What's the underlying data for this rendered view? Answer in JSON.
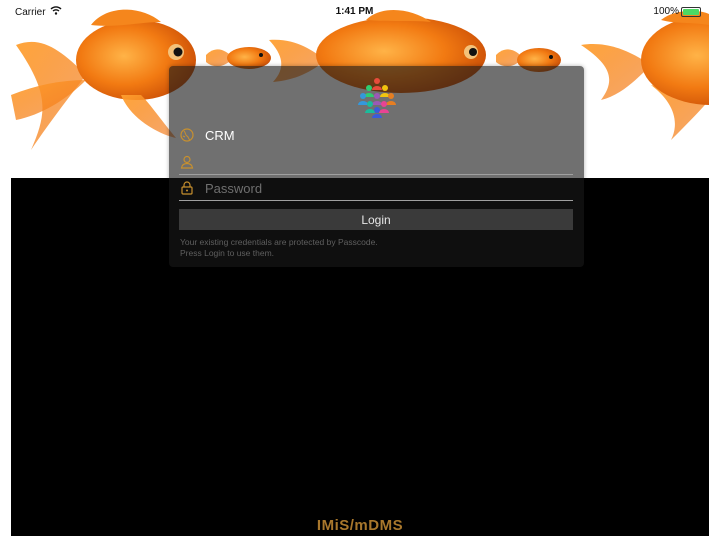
{
  "status_bar": {
    "carrier": "Carrier",
    "time": "1:41 PM",
    "battery": "100%",
    "wifi_icon": "wifi-icon",
    "battery_icon": "battery-icon",
    "battery_color": "#4cd964"
  },
  "login": {
    "server_icon": "globe-icon",
    "server_name": "CRM",
    "username_icon": "user-icon",
    "username_value": "",
    "username_placeholder": "",
    "password_icon": "lock-icon",
    "password_placeholder": "Password",
    "login_button": "Login",
    "note_line1": "Your existing credentials are protected by Passcode.",
    "note_line2": "Press Login to use them.",
    "accent_color": "#c8902e"
  },
  "footer": {
    "brand": "IMiS/mDMS"
  }
}
